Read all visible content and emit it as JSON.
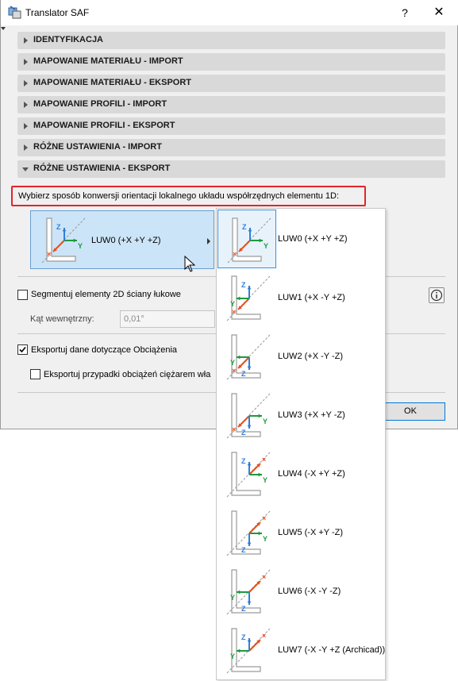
{
  "window": {
    "title": "Translator SAF",
    "help_label": "?",
    "close_label": "✕"
  },
  "sections": [
    {
      "label": "IDENTYFIKACJA",
      "expanded": false
    },
    {
      "label": "MAPOWANIE MATERIAŁU - IMPORT",
      "expanded": false
    },
    {
      "label": "MAPOWANIE MATERIAŁU - EKSPORT",
      "expanded": false
    },
    {
      "label": "MAPOWANIE PROFILI - IMPORT",
      "expanded": false
    },
    {
      "label": "MAPOWANIE PROFILI - EKSPORT",
      "expanded": false
    },
    {
      "label": "RÓŻNE USTAWIENIA - IMPORT",
      "expanded": false
    },
    {
      "label": "RÓŻNE USTAWIENIA - EKSPORT",
      "expanded": true
    }
  ],
  "export_settings": {
    "orientation_prompt": "Wybierz sposób konwersji orientacji lokalnego układu współrzędnych elementu 1D:",
    "selected_option": "LUW0 (+X +Y +Z)",
    "segment_walls_label": "Segmentuj elementy 2D ściany łukowe",
    "segment_walls_checked": false,
    "inner_angle_label": "Kąt wewnętrzny:",
    "inner_angle_value": "0,01°",
    "export_loads_label": "Eksportuj dane dotyczące Obciążenia",
    "export_loads_checked": true,
    "export_selfweight_label": "Eksportuj przypadki obciążeń ciężarem wła",
    "export_selfweight_checked": false,
    "ok_label": "OK"
  },
  "dropdown": {
    "options": [
      {
        "label": "LUW0 (+X +Y +Z)",
        "selected": true
      },
      {
        "label": "LUW1 (+X -Y +Z)",
        "selected": false
      },
      {
        "label": "LUW2 (+X -Y -Z)",
        "selected": false
      },
      {
        "label": "LUW3 (+X +Y -Z)",
        "selected": false
      },
      {
        "label": "LUW4 (-X +Y +Z)",
        "selected": false
      },
      {
        "label": "LUW5 (-X +Y -Z)",
        "selected": false
      },
      {
        "label": "LUW6 (-X -Y -Z)",
        "selected": false
      },
      {
        "label": "LUW7 (-X -Y +Z (Archicad))",
        "selected": false
      }
    ]
  },
  "icons": {
    "app": "saf-translator-icon",
    "info": "info-icon",
    "cursor": "mouse-pointer-icon"
  },
  "colors": {
    "selection_fill": "#cce4f7",
    "selection_border": "#6a9ed1",
    "highlight_red": "#e0262a",
    "axis_x": "#e8501e",
    "axis_y": "#1e9a3c",
    "axis_z": "#2f7fd8",
    "ok_border": "#0078d7"
  },
  "axis_glyphs": {
    "x": "×",
    "y": "Y",
    "z": "Z"
  }
}
